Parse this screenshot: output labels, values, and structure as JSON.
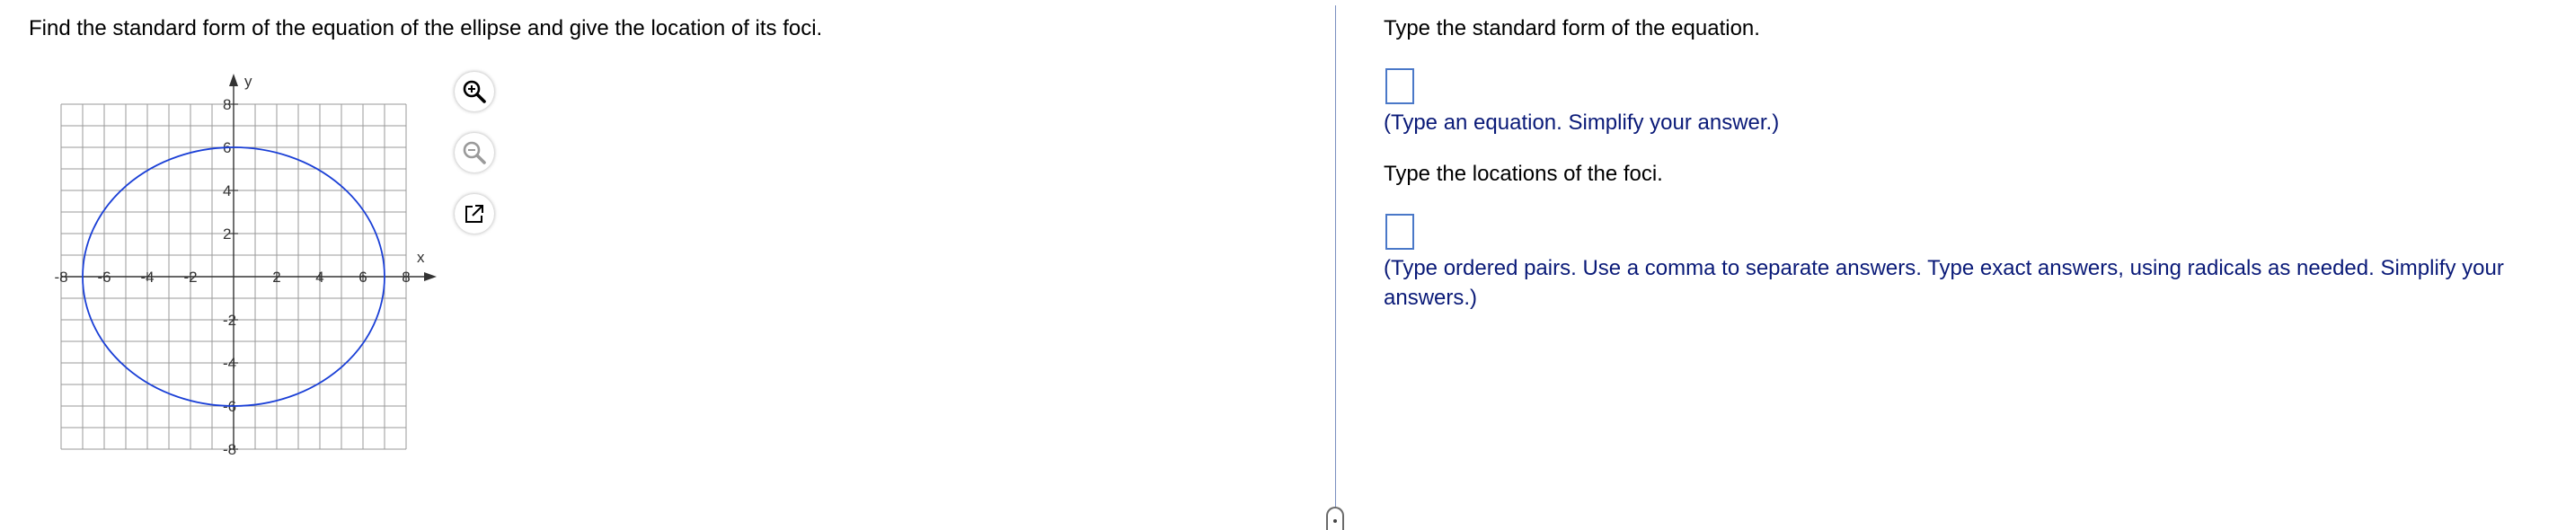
{
  "question": {
    "text": "Find the standard form of the equation of the ellipse and give the location of its foci."
  },
  "graph": {
    "x_axis_label": "x",
    "y_axis_label": "y",
    "x_range": [
      -8,
      8
    ],
    "y_range": [
      -8,
      8
    ],
    "x_tick_labels": [
      "-8",
      "-6",
      "-4",
      "-2",
      "2",
      "4",
      "6",
      "8"
    ],
    "y_tick_labels": [
      "8",
      "6",
      "4",
      "2",
      "-2",
      "-4",
      "-6",
      "-8"
    ],
    "ellipse": {
      "center": [
        0,
        0
      ],
      "semi_x": 7,
      "semi_y": 6,
      "color": "#1a3fd6"
    },
    "grid_color": "#9a9a9a",
    "axis_color": "#333333"
  },
  "tools": {
    "zoom_in": "zoom-in-icon",
    "zoom_out": "zoom-out-icon",
    "popout": "popout-icon"
  },
  "answers": {
    "equation_prompt": "Type the standard form of the equation.",
    "equation_hint": "(Type an equation. Simplify your answer.)",
    "foci_prompt": "Type the locations of the foci.",
    "foci_hint": "(Type ordered pairs. Use a comma to separate answers. Type exact answers, using radicals as needed. Simplify your answers.)"
  },
  "colors": {
    "hint_text": "#0a1a78",
    "answer_box_border": "#4a78c8",
    "divider": "#7a8fc0"
  }
}
